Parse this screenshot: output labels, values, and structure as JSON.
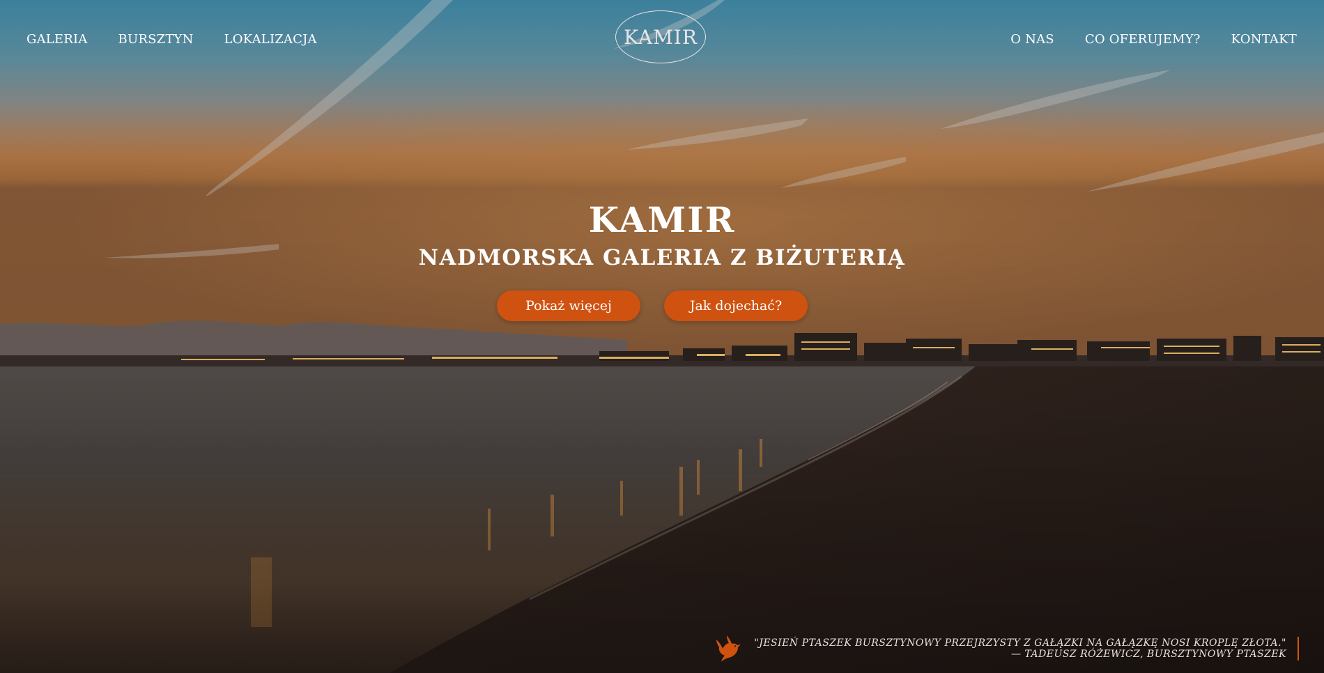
{
  "nav": {
    "left": [
      {
        "label": "GALERIA"
      },
      {
        "label": "BURSZTYN"
      },
      {
        "label": "LOKALIZACJA"
      }
    ],
    "logo": "KAMIR",
    "right": [
      {
        "label": "O NAS"
      },
      {
        "label": "CO OFERUJEMY?"
      },
      {
        "label": "KONTAKT"
      }
    ]
  },
  "hero": {
    "title": "KAMIR",
    "subtitle": "NADMORSKA GALERIA Z BIŻUTERIĄ",
    "buttons": {
      "show_more": "Pokaż więcej",
      "directions": "Jak dojechać?"
    }
  },
  "quote": {
    "text": "\"JESIEŃ PTASZEK BURSZTYNOWY PRZEJRZYSTY Z GAŁĄZKI NA GAŁĄZKĘ NOSI KROPLĘ ZŁOTA.\"",
    "author": "— TADEUSZ RÓŻEWICZ, BURSZTYNOWY PTASZEK",
    "icon": "bird-icon"
  },
  "colors": {
    "accent": "#cf5210",
    "text": "#ffffff"
  }
}
